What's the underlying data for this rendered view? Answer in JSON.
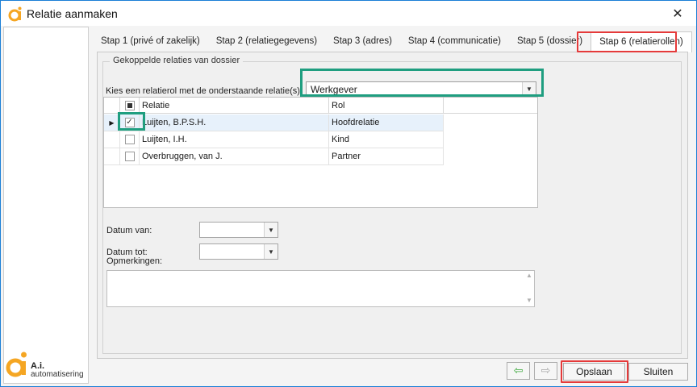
{
  "window": {
    "title": "Relatie aanmaken"
  },
  "branding": {
    "logo_line1": "A.i.",
    "logo_line2": "automatisering"
  },
  "tabs": [
    {
      "label": "Stap 1 (privé of zakelijk)"
    },
    {
      "label": "Stap 2 (relatiegegevens)"
    },
    {
      "label": "Stap 3 (adres)"
    },
    {
      "label": "Stap 4 (communicatie)"
    },
    {
      "label": "Stap 5 (dossier)"
    },
    {
      "label": "Stap 6 (relatierollen)"
    }
  ],
  "group": {
    "title": "Gekoppelde relaties van dossier",
    "role_label": "Kies een relatierol met de onderstaande relatie(s):",
    "role_value": "Werkgever"
  },
  "grid": {
    "headers": {
      "relatie": "Relatie",
      "rol": "Rol"
    },
    "rows": [
      {
        "relatie": "Luijten, B.P.S.H.",
        "rol": "Hoofdrelatie",
        "checked": true,
        "selected": true
      },
      {
        "relatie": "Luijten, I.H.",
        "rol": "Kind",
        "checked": false,
        "selected": false
      },
      {
        "relatie": "Overbruggen, van J.",
        "rol": "Partner",
        "checked": false,
        "selected": false
      }
    ]
  },
  "fields": {
    "datum_van": {
      "label": "Datum van:",
      "value": ""
    },
    "datum_tot": {
      "label": "Datum tot:",
      "value": ""
    },
    "opmerkingen": {
      "label": "Opmerkingen:",
      "value": ""
    }
  },
  "buttons": {
    "save": "Opslaan",
    "close": "Sluiten"
  },
  "icons": {
    "close": "close-icon",
    "back": "arrow-left-icon",
    "forward": "arrow-right-icon",
    "dropdown": "chevron-down-icon",
    "app": "ai-logo-icon"
  },
  "colors": {
    "accent": "#f5a623",
    "highlight_red": "#e53a3a",
    "highlight_green": "#1f9e80",
    "back_arrow": "#3aa83a"
  }
}
